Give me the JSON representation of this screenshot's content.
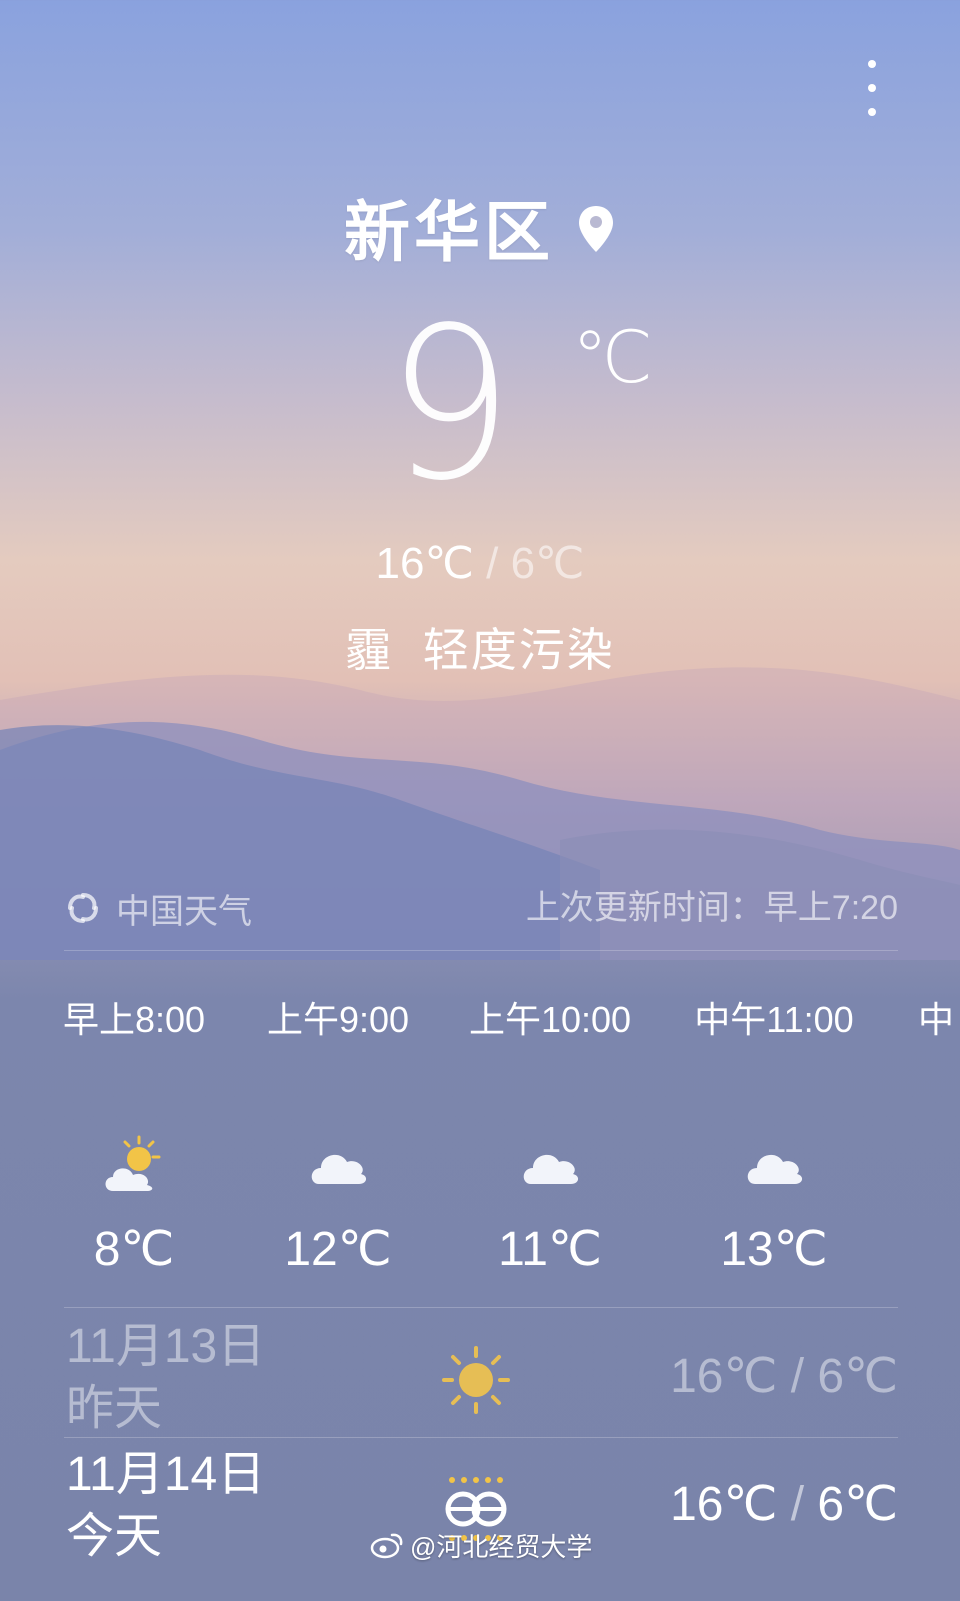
{
  "header": {
    "city": "新华区",
    "current_temp": "9",
    "temp_unit": "℃"
  },
  "today_range": {
    "high": "16℃",
    "separator": "/",
    "low": "6℃"
  },
  "condition": {
    "weather": "霾",
    "air_quality": "轻度污染"
  },
  "source": {
    "name": "中国天气",
    "updated": "上次更新时间：早上7:20"
  },
  "hourly": [
    {
      "time": "早上8:00",
      "icon": "partly-cloudy-icon",
      "temp": "8℃"
    },
    {
      "time": "上午9:00",
      "icon": "cloud-icon",
      "temp": "12℃"
    },
    {
      "time": "上午10:00",
      "icon": "cloud-icon",
      "temp": "11℃"
    },
    {
      "time": "中午11:00",
      "icon": "cloud-icon",
      "temp": "13℃"
    },
    {
      "time": "中",
      "icon": "",
      "temp": ""
    }
  ],
  "daily": [
    {
      "date": "11月13日",
      "label": "昨天",
      "icon": "sun-icon",
      "high": "16℃",
      "separator": "/",
      "low": "6℃"
    },
    {
      "date": "11月14日",
      "label": "今天",
      "icon": "haze-icon",
      "high": "16℃",
      "separator": "/",
      "low": "6℃"
    }
  ],
  "watermark": {
    "text": "@河北经贸大学"
  },
  "colors": {
    "sun": "#f2c447",
    "cloud": "#f2f4fa"
  }
}
